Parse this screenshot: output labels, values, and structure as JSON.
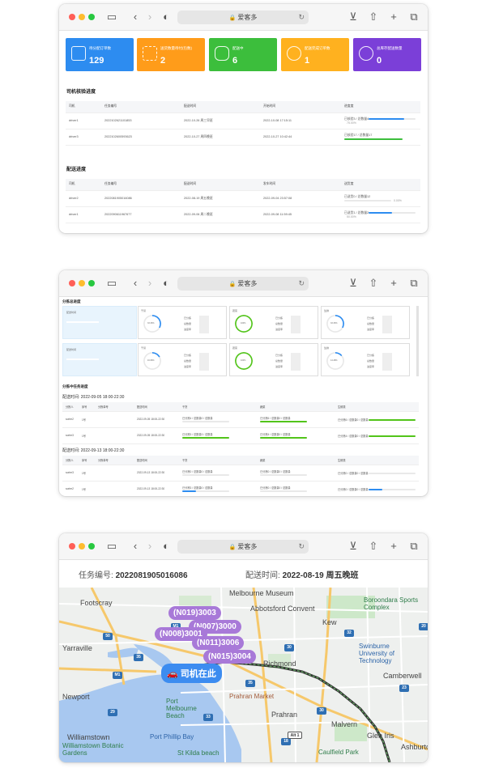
{
  "browser": {
    "url": "爱客多"
  },
  "dashboard": {
    "cards": [
      {
        "label": "待分配订单数",
        "value": "129",
        "color": "#2d8cf0"
      },
      {
        "label": "送货数量待付(包数)",
        "value": "2",
        "color": "#ff9c1a"
      },
      {
        "label": "配送中",
        "value": "6",
        "color": "#3cbe3c"
      },
      {
        "label": "配送完成订单数",
        "value": "1",
        "color": "#ffb11f"
      },
      {
        "label": "总库存配送数量",
        "value": "0",
        "color": "#7b3fd8"
      }
    ],
    "driver_section": "司机核验进度",
    "driver_headers": [
      "司机",
      "任务编号",
      "配送时间",
      "开始时间",
      "进度度"
    ],
    "driver_rows": [
      {
        "driver": "driver1",
        "task": "2022102621101853",
        "time": "2022-10-26 周三早班",
        "start": "2022-10-08 17:15:11",
        "plabel": "已核验3 / 总数量4",
        "pct": "75.00%",
        "fill": 0.75,
        "color": "#2d8cf0"
      },
      {
        "driver": "driver3",
        "task": "2022102600593623",
        "time": "2022-10-27 周四晚班",
        "start": "2022-10-27 10:42:44",
        "plabel": "已核验17 / 总数量17",
        "pct": "",
        "fill": 1.0,
        "color": "#3cbe3c"
      }
    ],
    "delivery_section": "配送进度",
    "delivery_headers": [
      "司机",
      "任务编号",
      "配送时间",
      "发车时间",
      "送货度"
    ],
    "delivery_rows": [
      {
        "driver": "driver2",
        "task": "2022081905016086",
        "time": "2022-08-19 周五晚班",
        "start": "2022-09-04 23:57:08",
        "plabel": "已送货0 / 总数量12",
        "pct": "0.00%",
        "fill": 0.0,
        "color": "#2d8cf0"
      },
      {
        "driver": "driver1",
        "task": "2022090611967677",
        "time": "2022-09-06 周二晚班",
        "start": "2022-09-08 11:59:45",
        "plabel": "已送货1 / 总数量2",
        "pct": "50.00%",
        "fill": 0.5,
        "color": "#2d8cf0"
      }
    ]
  },
  "sorting": {
    "overall_title": "分拣总进度",
    "rows": [
      {
        "label": "配送时间",
        "items": [
          {
            "name": "干货",
            "value": "33.33%",
            "fill": 0.33,
            "color": "#2d8cf0"
          },
          {
            "name": "蔬菜",
            "value": "100%",
            "fill": 1.0,
            "color": "#52c41a"
          },
          {
            "name": "生鲜",
            "value": "33.33%",
            "fill": 0.33,
            "color": "#2d8cf0"
          }
        ]
      },
      {
        "label": "配送时间",
        "items": [
          {
            "name": "干货",
            "value": "16.66%",
            "fill": 0.17,
            "color": "#2d8cf0"
          },
          {
            "name": "蔬菜",
            "value": "100%",
            "fill": 1.0,
            "color": "#52c41a"
          },
          {
            "name": "生鲜",
            "value": "14.28%",
            "fill": 0.14,
            "color": "#2d8cf0"
          }
        ]
      }
    ],
    "gauge_lines": [
      "已分拣",
      "总数量",
      "进度率"
    ],
    "task_title": "分拣中任务进度",
    "groups": [
      {
        "time": "配送时间: 2022-09-05 18:00-22:30",
        "headers": [
          "分拣人",
          "序号",
          "分拣单号",
          "配送时间",
          "干货",
          "蔬菜",
          "生鲜类"
        ],
        "rows": [
          {
            "who": "sorter2",
            "no": "1号",
            "date": "2022-09-05 18:00-22:30",
            "c1": "已分拣4 / 总数量0 / 总数量",
            "f1": 0.0,
            "c2": "已分拣6 / 总数量0 / 总数量",
            "f2": 1.0,
            "c3": "已分拣6 / 总数量0 / 总数量",
            "f3": 1.0
          },
          {
            "who": "sorter3",
            "no": "1号",
            "date": "2022-09-05 18:00-22:30",
            "c1": "已分拣3 / 总数量3 / 总数量",
            "f1": 1.0,
            "c2": "已分拣4 / 总数量0 / 总数量",
            "f2": 1.0,
            "c3": "已分拣4 / 总数量0 / 总数量",
            "f3": 1.0
          }
        ]
      },
      {
        "time": "配送时间: 2022-09-13 18:00-22:30",
        "headers": [
          "分拣人",
          "序号",
          "分拣单号",
          "配送时间",
          "干货",
          "蔬菜",
          "生鲜类"
        ],
        "rows": [
          {
            "who": "sorter3",
            "no": "1号",
            "date": "2022-09-13 18:00-22:30",
            "c1": "已分拣0 / 总数量0 / 总数量",
            "f1": 0.0,
            "c2": "已分拣0 / 总数量0 / 总数量",
            "f2": 0.0,
            "c3": "已分拣0 / 总数量0 / 总数量",
            "f3": 0.0
          },
          {
            "who": "sorter2",
            "no": "1号",
            "date": "2022-09-13 18:00-22:30",
            "c1": "已分拣3 / 总数量0 / 总数量",
            "f1": 0.3,
            "c2": "已分拣0 / 总数量0 / 总数量",
            "f2": 0.0,
            "c3": "已分拣0 / 总数量0 / 总数量",
            "f3": 0.3
          }
        ]
      }
    ]
  },
  "route": {
    "task_label": "任务编号:",
    "task_no": "2022081905016086",
    "time_label": "配送时间:",
    "time_value": "2022-08-19 周五晚班",
    "markers": [
      "(N019)3003",
      "(N007)3000",
      "(N008)3001",
      "(N011)3006",
      "(N015)3004"
    ],
    "driver_marker": "司机在此",
    "places": [
      "Footscray",
      "Abbotsford Convent",
      "Boroondara Sports Complex",
      "Melbourne Museum",
      "Yarraville",
      "Kew",
      "Richmond",
      "Swinburne University of Technology",
      "Camberwell",
      "Newport",
      "Port Melbourne Beach",
      "Prahran Market",
      "Prahran",
      "Malvern",
      "Glen Iris",
      "Ashburton",
      "Williamstown",
      "Williamstown Botanic Gardens",
      "Port Phillip Bay",
      "St Kilda beach",
      "Caulfield Park"
    ],
    "road_badges": [
      "M1",
      "M1",
      "50",
      "30",
      "32",
      "20",
      "35",
      "29",
      "35",
      "30",
      "33",
      "23",
      "18",
      "Alt 1"
    ]
  }
}
